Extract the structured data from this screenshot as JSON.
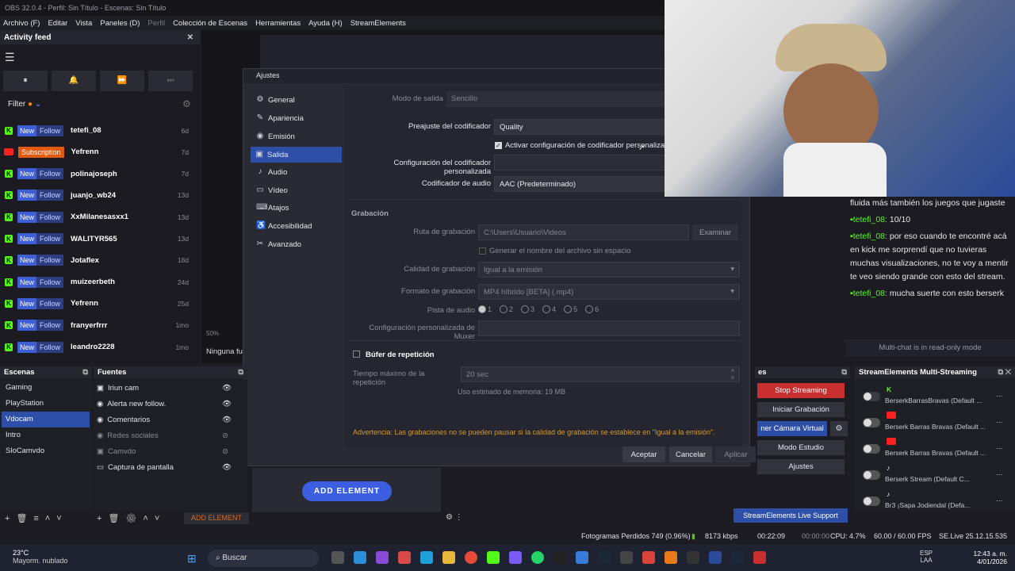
{
  "window": {
    "title": "OBS 32.0.4 - Perfil: Sin Título - Escenas: Sin Título"
  },
  "menu": {
    "items": [
      "Archivo (F)",
      "Editar",
      "Vista",
      "Paneles (D)",
      "Perfil",
      "Colección de Escenas",
      "Herramientas",
      "Ayuda (H)",
      "StreamElements"
    ]
  },
  "activity": {
    "title": "Activity feed",
    "filter": "Filter",
    "feed": [
      {
        "platform": "kick",
        "badge1": "New",
        "badge2": "Follow",
        "name": "tetefi_08",
        "time": "6d"
      },
      {
        "platform": "youtube",
        "badge1": "",
        "badge2": "Subscription",
        "name": "Yefrenn",
        "time": "7d"
      },
      {
        "platform": "kick",
        "badge1": "New",
        "badge2": "Follow",
        "name": "polinajoseph",
        "time": "7d"
      },
      {
        "platform": "kick",
        "badge1": "New",
        "badge2": "Follow",
        "name": "juanjo_wb24",
        "time": "13d"
      },
      {
        "platform": "kick",
        "badge1": "New",
        "badge2": "Follow",
        "name": "XxMilanesasxx1",
        "time": "13d"
      },
      {
        "platform": "kick",
        "badge1": "New",
        "badge2": "Follow",
        "name": "WALITYR565",
        "time": "13d"
      },
      {
        "platform": "kick",
        "badge1": "New",
        "badge2": "Follow",
        "name": "Jotaflex",
        "time": "18d"
      },
      {
        "platform": "kick",
        "badge1": "New",
        "badge2": "Follow",
        "name": "muizeerbeth",
        "time": "24d"
      },
      {
        "platform": "kick",
        "badge1": "New",
        "badge2": "Follow",
        "name": "Yefrenn",
        "time": "25d"
      },
      {
        "platform": "kick",
        "badge1": "New",
        "badge2": "Follow",
        "name": "franyerfrrr",
        "time": "1mo"
      },
      {
        "platform": "kick",
        "badge1": "New",
        "badge2": "Follow",
        "name": "leandro2228",
        "time": "1mo"
      }
    ]
  },
  "settings": {
    "title": "Ajustes",
    "nav": [
      "General",
      "Apariencia",
      "Emisión",
      "Salida",
      "Audio",
      "Vídeo",
      "Atajos",
      "Accesibilidad",
      "Avanzado"
    ],
    "modo_label": "Modo de salida",
    "modo_value": "Sencillo",
    "preajuste_label": "Preajuste del codificador",
    "preajuste_value": "Quality",
    "activar_label": "Activar configuración de codificador personalizada",
    "config_cod_label": "Configuración del codificador personalizada",
    "cod_audio_label": "Codificador de audio",
    "cod_audio_value": "AAC (Predeterminado)",
    "grabacion": "Grabación",
    "ruta_label": "Ruta de grabación",
    "ruta_value": "C:\\Users\\Usuario\\Videos",
    "examinar": "Examinar",
    "generar": "Generar el nombre del archivo sin espacio",
    "calidad_label": "Calidad de grabación",
    "calidad_value": "Igual a la emisión",
    "formato_label": "Formato de grabación",
    "formato_value": "MP4 híbrido [BETA] (.mp4)",
    "pista_label": "Pista de audio",
    "pistas": [
      "1",
      "2",
      "3",
      "4",
      "5",
      "6"
    ],
    "muxer_label": "Configuración personalizada de Muxer",
    "bufer": "Búfer de repetición",
    "tiempo_label": "Tiempo máximo de la repetición",
    "tiempo_value": "20 sec",
    "memoria": "Uso estimado de memoria: 19 MB",
    "warning": "Advertencia: Las grabaciones no se pueden pausar si la calidad de grabación se establece en \"Igual a la emisión\".",
    "aceptar": "Aceptar",
    "cancelar": "Cancelar",
    "aplicar": "Aplicar"
  },
  "preview": {
    "zoom": "50%",
    "ninguna": "Ninguna fu",
    "add_element": "ADD ELEMENT"
  },
  "scenes": {
    "title": "Escenas",
    "items": [
      "Gaming",
      "PlayStation",
      "Vdocam",
      "Intro",
      "SloCamvdo"
    ]
  },
  "sources": {
    "title": "Fuentes",
    "items": [
      "Iriun cam",
      "Alerta new follow.",
      "Comentarios",
      "Redes sociales",
      "Camvdo",
      "Captura de pantalla"
    ],
    "add_element": "ADD ELEMENT"
  },
  "controls": {
    "stop": "Stop Streaming",
    "grabacion": "Iniciar Grabación",
    "camara": "ner Cámara Virtual",
    "estudio": "Modo Estudio",
    "ajustes": "Ajustes",
    "support": "StreamElements Live Support"
  },
  "chat": {
    "lines_intro": "fluida más también los juegos que jugaste",
    "m1_user": "tetefi_08:",
    "m1": " 10/10",
    "m2_user": "tetefi_08:",
    "m2": " por eso cuando te encontré acá en kick me sorprendí que no tuvieras muchas visualizaciones, no te voy a mentir te veo siendo grande con esto del stream.",
    "m3_user": "tetefi_08:",
    "m3": " mucha suerte con esto berserk",
    "readonly": "Multi-chat is in read-only mode"
  },
  "multistream": {
    "title": "StreamElements Multi-Streaming",
    "rows": [
      "BerserkBarrasBravas (Default ...",
      "Berserk Barras Bravas (Default ...",
      "Berserk Barras Bravas (Default ...",
      "Berserk Stream (Default C...",
      "Br3 ¡Sapa Jodiendal (Defa..."
    ]
  },
  "statusbar": {
    "frames": "Fotogramas Perdidos 749 (0.96%)",
    "kbps": "8173 kbps",
    "rec_time": "00:22:09",
    "stream_time": "00:00:00",
    "cpu": "CPU: 4.7%",
    "fps": "60.00 / 60.00 FPS",
    "version": "SE.Live 25.12.15.535"
  },
  "taskbar": {
    "temp": "23°C",
    "weather": "Mayorm. nublado",
    "search": "Buscar",
    "lang1": "ESP",
    "lang2": "LAA",
    "time": "12:43 a. m.",
    "date": "4/01/2026"
  }
}
